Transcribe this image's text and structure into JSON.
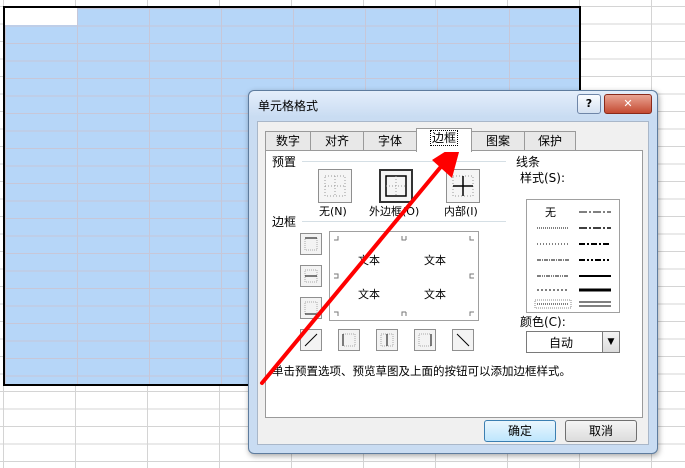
{
  "dialog": {
    "title": "单元格格式",
    "help_label": "?",
    "close_label": "✕",
    "tabs": [
      {
        "label": "数字"
      },
      {
        "label": "对齐"
      },
      {
        "label": "字体"
      },
      {
        "label": "边框",
        "active": true
      },
      {
        "label": "图案"
      },
      {
        "label": "保护"
      }
    ],
    "presets": {
      "group_label": "预置",
      "none_label": "无(N)",
      "outline_label": "外边框(O)",
      "inside_label": "内部(I)"
    },
    "border": {
      "group_label": "边框",
      "preview_texts": [
        "文本",
        "文本",
        "文本",
        "文本"
      ]
    },
    "line": {
      "group_label": "线条",
      "style_label": "样式(S):",
      "none_style_label": "无",
      "color_label": "颜色(C):",
      "color_value": "自动"
    },
    "hint": "单击预置选项、预览草图及上面的按钮可以添加边框样式。",
    "ok_label": "确定",
    "cancel_label": "取消"
  },
  "colors": {
    "selection": "#b6d6f8",
    "arrow": "#ff0000",
    "dialog_frame": "#c9dcf2"
  }
}
